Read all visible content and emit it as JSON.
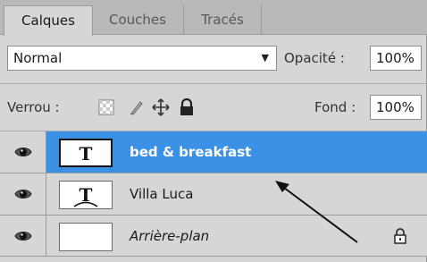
{
  "tabs": [
    {
      "label": "Calques",
      "active": true
    },
    {
      "label": "Couches",
      "active": false
    },
    {
      "label": "Tracés",
      "active": false
    }
  ],
  "blend_mode": {
    "value": "Normal"
  },
  "opacity": {
    "label": "Opacité :",
    "value": "100%"
  },
  "lock": {
    "label": "Verrou :",
    "icons": [
      "lock-transparent-pixels-icon",
      "lock-image-pixels-icon",
      "lock-position-icon",
      "lock-all-icon"
    ]
  },
  "fill": {
    "label": "Fond :",
    "value": "100%"
  },
  "layers": [
    {
      "name": "bed & breakfast",
      "thumbnail": "T",
      "selected": true,
      "visible": true
    },
    {
      "name": "Villa Luca",
      "thumbnail": "T",
      "selected": false,
      "visible": true
    },
    {
      "name": "Arrière-plan",
      "thumbnail": "",
      "selected": false,
      "visible": true,
      "locked": true
    }
  ],
  "colors": {
    "selection": "#3a91e6",
    "panel": "#d6d6d6",
    "tabbar": "#b9b9b9"
  }
}
